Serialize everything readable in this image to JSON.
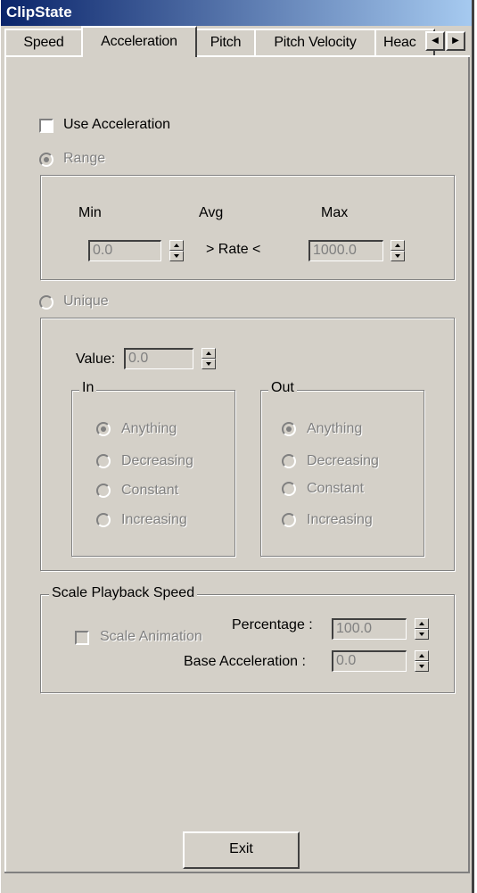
{
  "window": {
    "title": "ClipState"
  },
  "tabs": [
    "Speed",
    "Acceleration",
    "Pitch",
    "Pitch Velocity",
    "Heac"
  ],
  "active_tab": "Acceleration",
  "use_acceleration": {
    "label": "Use Acceleration",
    "checked": false
  },
  "range": {
    "label": "Range",
    "selected": true,
    "min_label": "Min",
    "avg_label": "Avg",
    "max_label": "Max",
    "min_value": "0.0",
    "max_value": "1000.0",
    "rate_label": "> Rate <"
  },
  "unique": {
    "label": "Unique",
    "selected": false,
    "value_label": "Value:",
    "value": "0.0",
    "in_group": {
      "title": "In",
      "options": [
        "Anything",
        "Decreasing",
        "Constant",
        "Increasing"
      ],
      "selected": "Anything"
    },
    "out_group": {
      "title": "Out",
      "options": [
        "Anything",
        "Decreasing",
        "Constant",
        "Increasing"
      ],
      "selected": "Anything"
    }
  },
  "scale_playback": {
    "title": "Scale Playback Speed",
    "scale_animation_label": "Scale Animation",
    "scale_animation_checked": false,
    "percentage_label": "Percentage :",
    "percentage_value": "100.0",
    "base_accel_label": "Base Acceleration :",
    "base_accel_value": "0.0"
  },
  "exit_label": "Exit"
}
